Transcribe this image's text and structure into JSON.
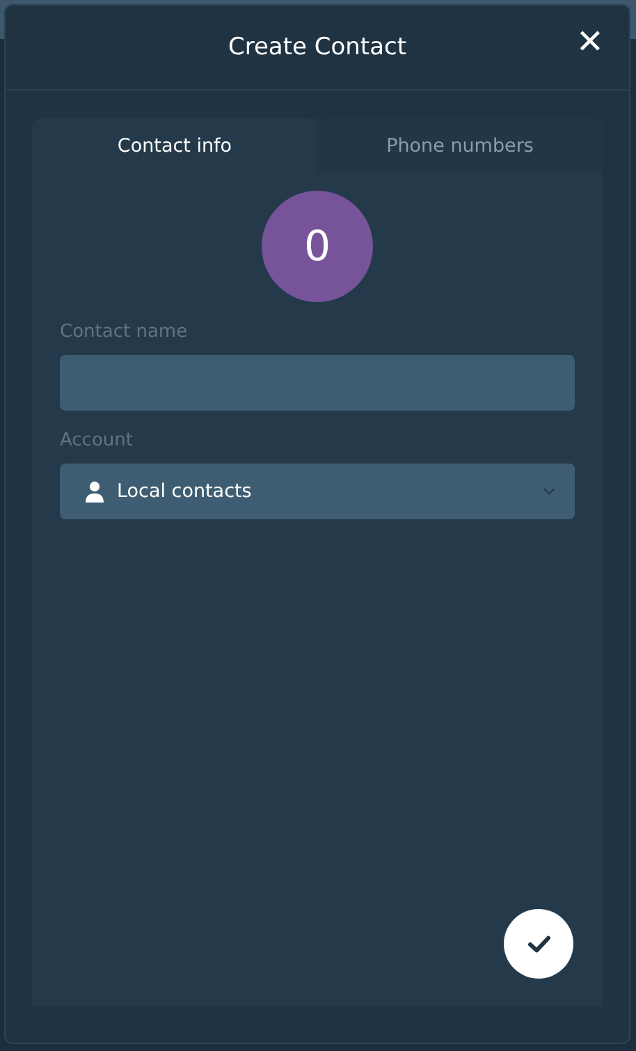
{
  "dialog": {
    "title": "Create Contact",
    "close": "✕"
  },
  "tabs": [
    {
      "label": "Contact info",
      "selected": true
    },
    {
      "label": "Phone numbers",
      "selected": false
    }
  ],
  "avatar": {
    "initial": "0",
    "color": "#77549a"
  },
  "fields": [
    {
      "kind": "text",
      "label": "Contact name"
    },
    {
      "kind": "select",
      "label": "Account",
      "value": "Local contacts"
    }
  ]
}
